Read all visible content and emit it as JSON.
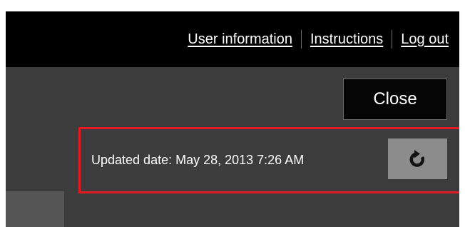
{
  "header": {
    "links": {
      "user_information": "User information",
      "instructions": "Instructions",
      "log_out": "Log out"
    }
  },
  "dialog": {
    "close_label": "Close"
  },
  "status": {
    "updated_date": "Updated date: May 28, 2013 7:26 AM",
    "refresh_icon": "refresh-icon"
  },
  "colors": {
    "topbar": "#000000",
    "background": "#3c3c3c",
    "highlight_border": "#e31b23",
    "refresh_button": "#8c8c8c"
  }
}
